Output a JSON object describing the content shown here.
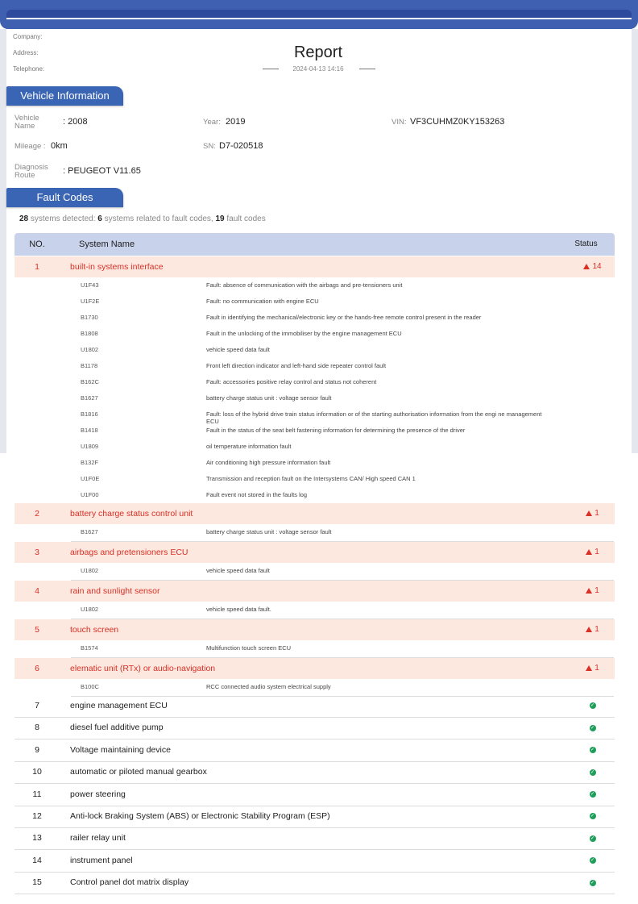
{
  "header": {
    "company_label": "Company:",
    "address_label": "Address:",
    "telephone_label": "Telephone:",
    "title": "Report",
    "date": "2024-04-13 14:16"
  },
  "vehicle": {
    "section": "Vehicle Information",
    "name_label_1": "Vehicle",
    "name_label_2": "Name",
    "name_value": "2008",
    "year_label": "Year:",
    "year_value": "2019",
    "vin_label": "VIN:",
    "vin_value": "VF3CUHMZ0KY153263",
    "mileage_label": "Mileage :",
    "mileage_value": "0km",
    "sn_label": "SN:",
    "sn_value": "D7-020518",
    "route_label_1": "Diagnosis",
    "route_label_2": "Route",
    "route_value": "PEUGEOT V11.65"
  },
  "fault": {
    "section": "Fault Codes",
    "systems_count": "28",
    "systems_text": " systems detected: ",
    "related_count": "6",
    "related_text": " systems related to fault codes, ",
    "codes_count": "19",
    "codes_text": " fault codes",
    "col_no": "NO.",
    "col_name": "System Name",
    "col_status": "Status"
  },
  "fault_systems": [
    {
      "no": "1",
      "name": "built-in systems interface",
      "count": "14",
      "codes": [
        [
          "U1F43",
          "Fault: absence of communication with the airbags and pre-tensioners unit"
        ],
        [
          "U1F2E",
          "Fault: no communication with engine ECU"
        ],
        [
          "B1730",
          "Fault in identifying the mechanical/electronic key or the hands-free remote control present in the reader"
        ],
        [
          "B1808",
          "Fault in the unlocking of the immobiliser by the engine management ECU"
        ],
        [
          "U1802",
          "vehicle speed data fault"
        ],
        [
          "B1178",
          "Front left direction indicator and left-hand side repeater control fault"
        ],
        [
          "B162C",
          "Fault: accessories positive relay control and status not coherent"
        ],
        [
          "B1627",
          "battery charge status unit : voltage sensor fault"
        ],
        [
          "B1816",
          "Fault: loss of the hybrid drive train status information or of the starting authorisation information from the engi ne management ECU"
        ],
        [
          "B1418",
          "Fault in the status of the seat belt fastening information for determining the presence of the driver"
        ],
        [
          "U1809",
          "oil temperature information fault"
        ],
        [
          "B132F",
          "Air conditioning high pressure information fault"
        ],
        [
          "U1F0E",
          "Transmission and reception fault on the Intersystems CAN/ High speed CAN 1"
        ],
        [
          "U1F00",
          "Fault event not stored in the faults log"
        ]
      ]
    },
    {
      "no": "2",
      "name": "battery charge status control unit",
      "count": "1",
      "codes": [
        [
          "B1627",
          "battery charge status unit : voltage sensor fault"
        ]
      ]
    },
    {
      "no": "3",
      "name": "airbags and pretensioners ECU",
      "count": "1",
      "codes": [
        [
          "U1802",
          "vehicle speed data fault"
        ]
      ]
    },
    {
      "no": "4",
      "name": "rain and sunlight sensor",
      "count": "1",
      "codes": [
        [
          "U1802",
          "vehicle speed data fault."
        ]
      ]
    },
    {
      "no": "5",
      "name": "touch screen",
      "count": "1",
      "codes": [
        [
          "B1574",
          "Multifunction touch screen ECU"
        ]
      ]
    },
    {
      "no": "6",
      "name": "elematic unit (RTx) or audio-navigation",
      "count": "1",
      "codes": [
        [
          "B100C",
          "RCC connected audio system electrical supply"
        ]
      ]
    }
  ],
  "ok_systems": [
    {
      "no": "7",
      "name": "engine management ECU"
    },
    {
      "no": "8",
      "name": "diesel fuel additive pump"
    },
    {
      "no": "9",
      "name": "Voltage maintaining device"
    },
    {
      "no": "10",
      "name": "automatic or piloted manual gearbox"
    },
    {
      "no": "11",
      "name": "power steering"
    },
    {
      "no": "12",
      "name": "Anti-lock Braking System (ABS) or Electronic Stability Program (ESP)"
    },
    {
      "no": "13",
      "name": "railer relay unit"
    },
    {
      "no": "14",
      "name": "instrument panel"
    },
    {
      "no": "15",
      "name": "Control panel dot matrix display"
    }
  ],
  "colors": {
    "accent": "#3a64b4",
    "fault_bg": "#fde8e0",
    "fault_text": "#d93025",
    "ok": "#1e9e5a"
  }
}
